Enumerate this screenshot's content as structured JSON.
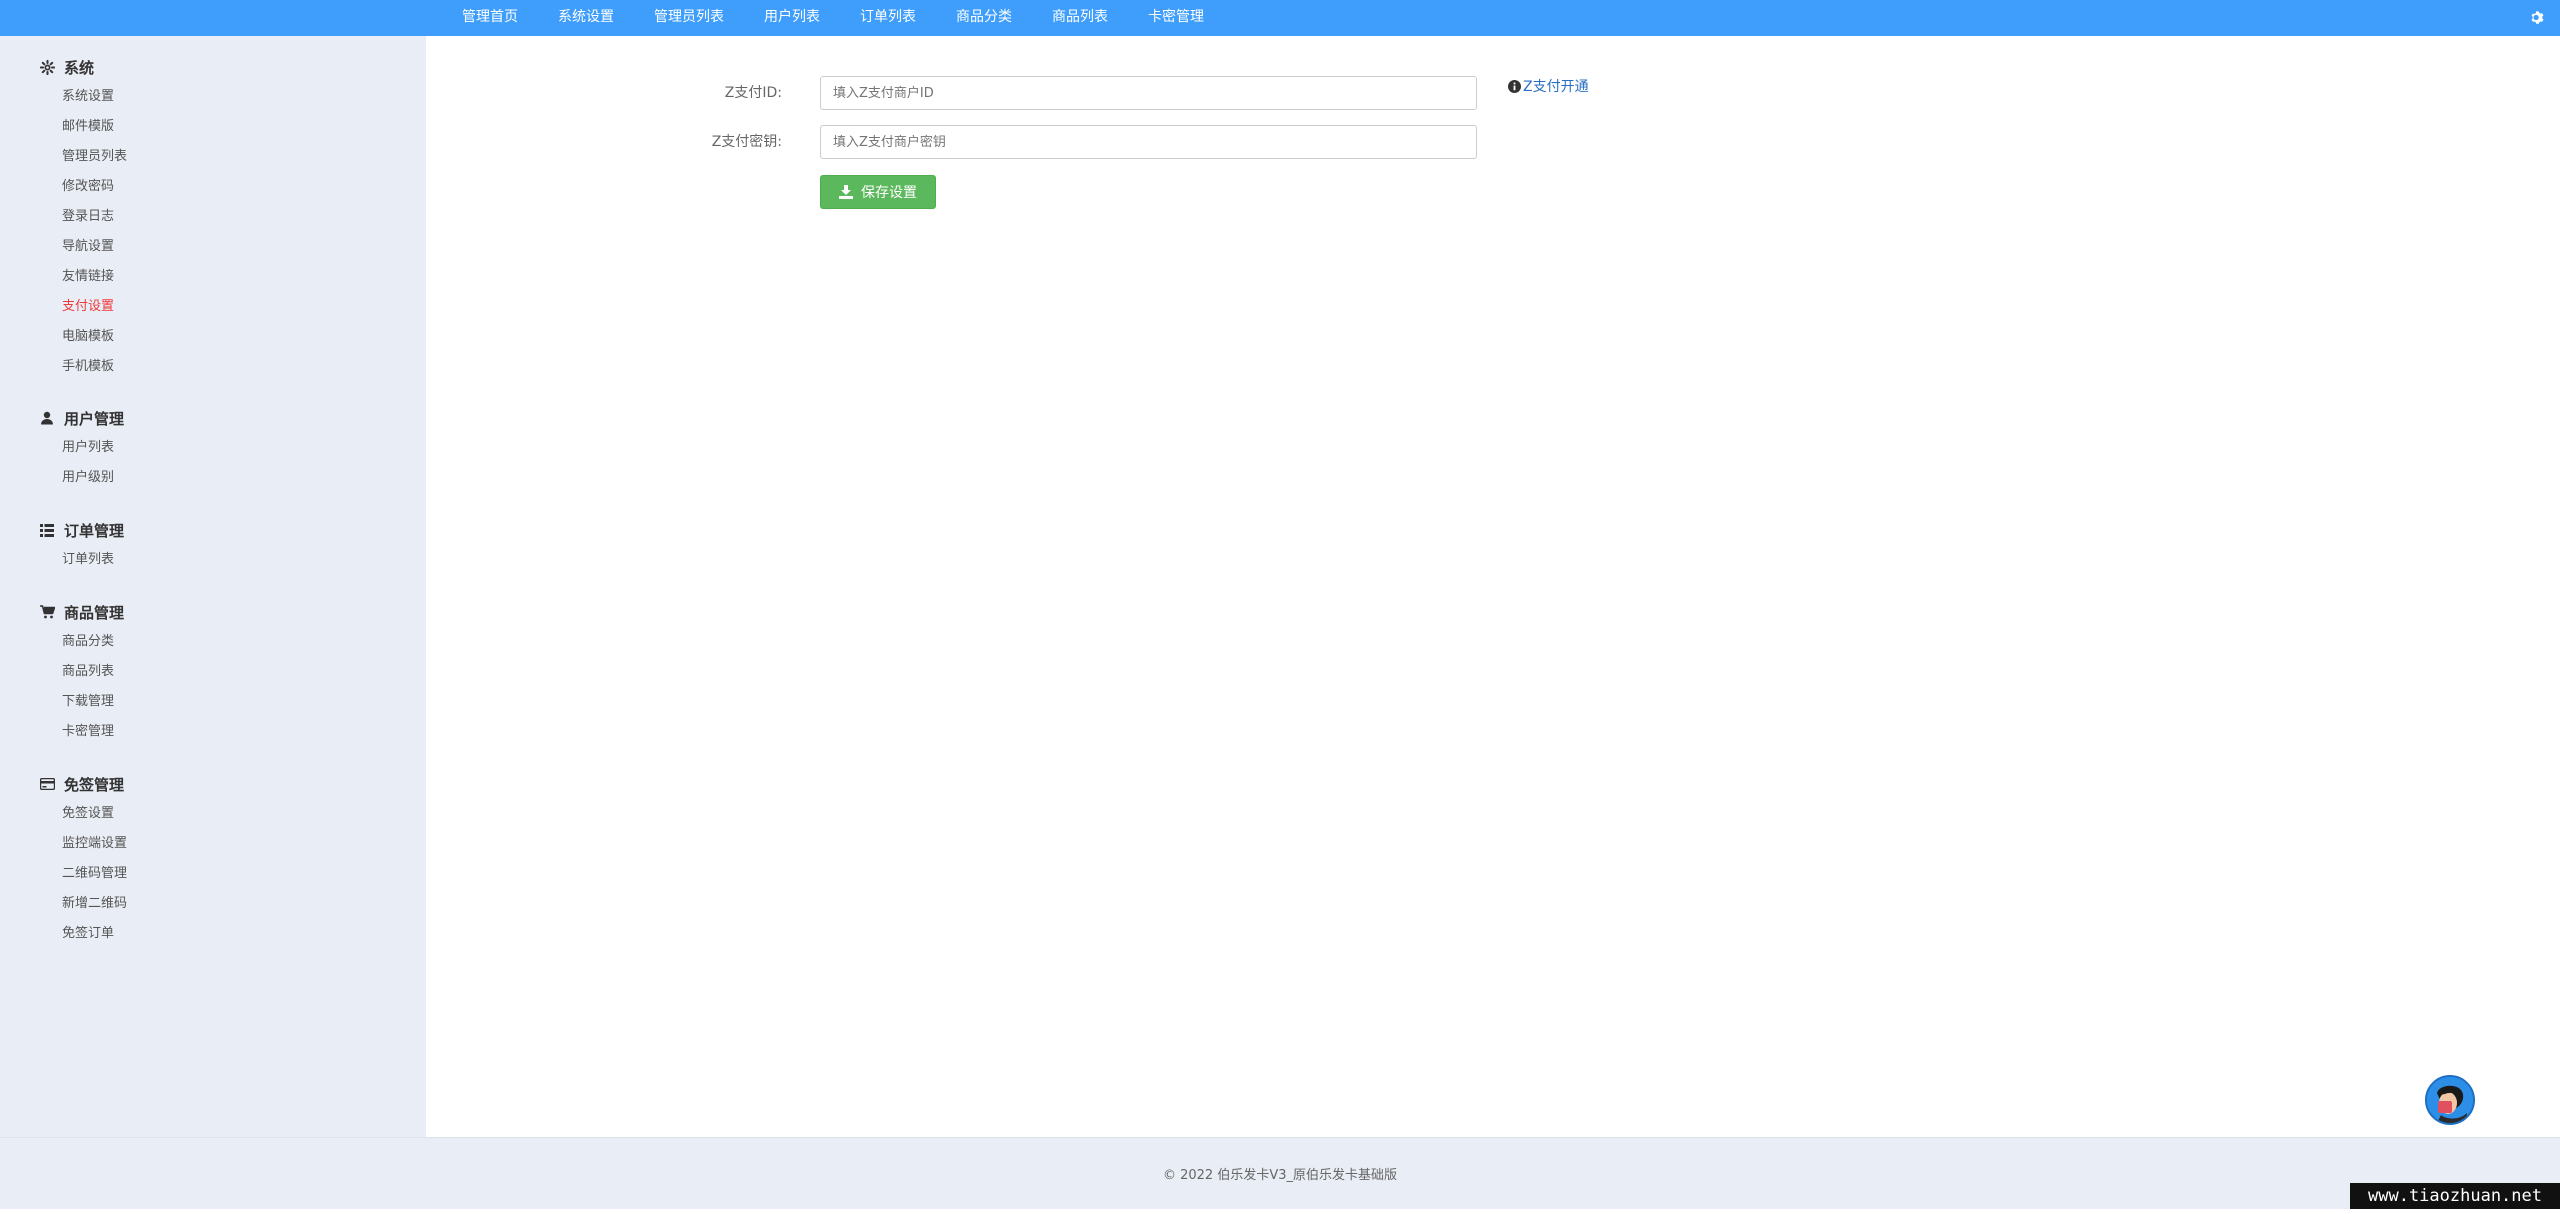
{
  "topnav": {
    "items": [
      "管理首页",
      "系统设置",
      "管理员列表",
      "用户列表",
      "订单列表",
      "商品分类",
      "商品列表",
      "卡密管理"
    ],
    "settings_icon": "gear-icon"
  },
  "sidebar": {
    "sections": [
      {
        "title": "系统",
        "icon": "gear-icon",
        "items": [
          "系统设置",
          "邮件模版",
          "管理员列表",
          "修改密码",
          "登录日志",
          "导航设置",
          "友情链接",
          "支付设置",
          "电脑模板",
          "手机模板"
        ]
      },
      {
        "title": "用户管理",
        "icon": "user-icon",
        "items": [
          "用户列表",
          "用户级别"
        ]
      },
      {
        "title": "订单管理",
        "icon": "list-icon",
        "items": [
          "订单列表"
        ]
      },
      {
        "title": "商品管理",
        "icon": "cart-icon",
        "items": [
          "商品分类",
          "商品列表",
          "下载管理",
          "卡密管理"
        ]
      },
      {
        "title": "免签管理",
        "icon": "credit-card-icon",
        "items": [
          "免签设置",
          "监控端设置",
          "二维码管理",
          "新增二维码",
          "免签订单"
        ]
      }
    ],
    "active_item": "支付设置"
  },
  "form": {
    "id_label": "Z支付ID:",
    "id_placeholder": "填入Z支付商户ID",
    "key_label": "Z支付密钥:",
    "key_placeholder": "填入Z支付商户密钥",
    "help_link": "Z支付开通",
    "save_label": "保存设置"
  },
  "footer": {
    "copyright": "©  2022 伯乐发卡V3_原伯乐发卡基础版"
  },
  "watermark": "www.tiaozhuan.net",
  "colors": {
    "topbar": "#3f9efb",
    "sidebar_bg": "#e9edf5",
    "active_item": "#ef3a3a",
    "save_button": "#5cb85c",
    "link": "#2a6fc4"
  }
}
